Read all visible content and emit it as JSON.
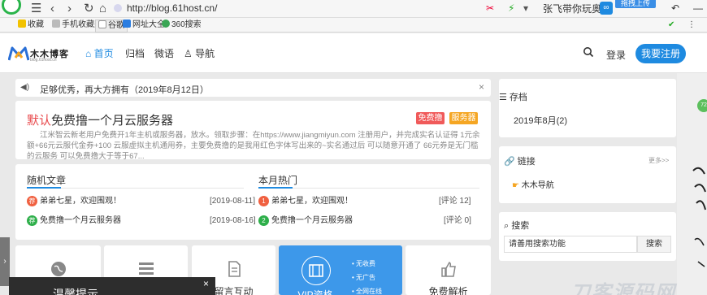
{
  "browser": {
    "url": "http://blog.61host.cn/",
    "news": "张飞带你玩奥汀",
    "upload_label": "拖拽上传",
    "bookmarks": [
      "收藏",
      "手机收藏夹",
      "谷歌",
      "网址大全",
      "360搜索"
    ]
  },
  "header": {
    "logo_text": "木木博客",
    "logo_sub": "blog.61host.cn",
    "nav": [
      "首页",
      "归档",
      "微语",
      "导航"
    ],
    "login": "登录",
    "register": "我要注册"
  },
  "notice": {
    "text": "足够优秀，再大方拥有（2019年8月12日）",
    "close": "×"
  },
  "featured": {
    "title_highlight": "默认",
    "title": "免费撸一个月云服务器",
    "tags": [
      {
        "label": "免费撸",
        "color": "#f05a5a"
      },
      {
        "label": "服务器",
        "color": "#f5a623"
      }
    ],
    "desc": "江米智云新老用户免费开1年主机或服务器，放水。领取步骤：在https://www.jiangmiyun.com 注册用户，并完成实名认证得 1元余额+66元云服代金券+100 云服虚拟主机通用券，主要免费撸的是我用红色字体写出来的~实名通过后 可以随意开通了 66元券是无门槛的云服务 可以免费撸大于等于67..."
  },
  "random": {
    "title": "随机文章",
    "items": [
      {
        "badge": "荐",
        "text": "弟弟七星，欢迎围观！",
        "date": "[2019-08-11]"
      },
      {
        "badge": "荐",
        "text": "免费撸一个月云服务器",
        "date": "[2019-08-16]"
      }
    ]
  },
  "hot": {
    "title": "本月热门",
    "items": [
      {
        "badge": "1",
        "text": "弟弟七星，欢迎围观！",
        "comments": "[评论 12]"
      },
      {
        "badge": "2",
        "text": "免费撸一个月云服务器",
        "comments": "[评论 0]"
      }
    ]
  },
  "tiles": {
    "message": "留言互动",
    "vip": "VIP资格",
    "vip_points": [
      "无收费",
      "无广告",
      "全网在线"
    ],
    "parse": "免费解析"
  },
  "popup": {
    "title": "温馨提示",
    "close": "×"
  },
  "sidebar": {
    "archive_title": "存档",
    "archive_item": "2019年8月(2)",
    "links_title": "链接",
    "links_more": "更多>>",
    "link_item": "木木导航",
    "search_title": "搜索",
    "search_placeholder": "请善用搜索功能",
    "search_button": "搜索"
  },
  "float_badge": "72",
  "watermark": "刀客源码网",
  "colors": {
    "accent": "#1e8ae0",
    "red": "#e8484b",
    "green": "#2eaf4a"
  }
}
